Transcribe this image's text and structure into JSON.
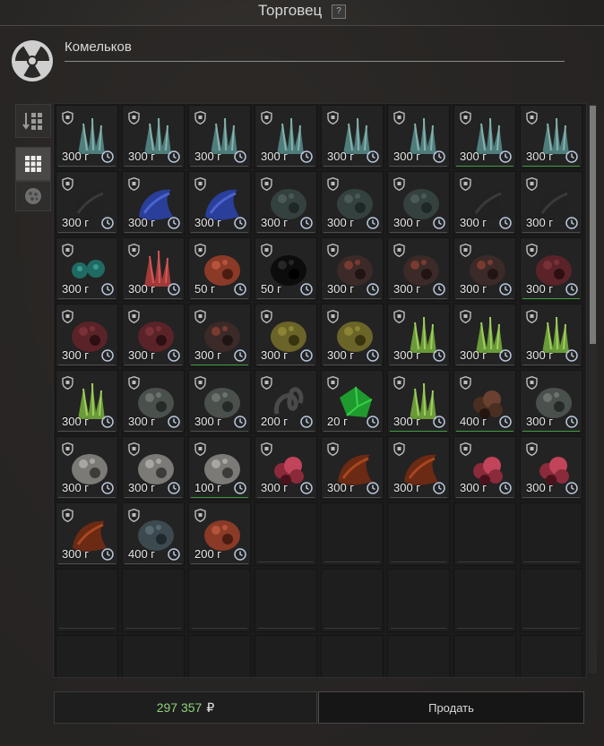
{
  "window": {
    "title": "Торговец",
    "help_label": "?"
  },
  "trader": {
    "name": "Комельков",
    "logo_icon": "radiation-icon"
  },
  "side_tools": [
    {
      "icon": "sort-icon",
      "active": false
    },
    {
      "icon": "grid-view-icon",
      "active": true
    },
    {
      "icon": "artifact-filter-icon",
      "active": false
    }
  ],
  "currency_suffix": "г",
  "colors": {
    "accent_green": "#3f9a3f",
    "total_green": "#8fd17a"
  },
  "grid": {
    "columns": 8,
    "rows": 9,
    "items": [
      {
        "price": "300 г",
        "art": "crystal-teal",
        "green": false
      },
      {
        "price": "300 г",
        "art": "crystal-teal",
        "green": false
      },
      {
        "price": "300 г",
        "art": "crystal-teal",
        "green": false
      },
      {
        "price": "300 г",
        "art": "crystal-teal",
        "green": false
      },
      {
        "price": "300 г",
        "art": "crystal-teal",
        "green": false
      },
      {
        "price": "300 г",
        "art": "crystal-teal",
        "green": false
      },
      {
        "price": "300 г",
        "art": "crystal-teal",
        "green": true
      },
      {
        "price": "300 г",
        "art": "crystal-teal",
        "green": true
      },
      {
        "price": "300 г",
        "art": "dark-claw",
        "green": false
      },
      {
        "price": "300 г",
        "art": "blue-shell",
        "green": false
      },
      {
        "price": "300 г",
        "art": "blue-shell",
        "green": false
      },
      {
        "price": "300 г",
        "art": "dark-cluster",
        "green": false
      },
      {
        "price": "300 г",
        "art": "dark-cluster",
        "green": false
      },
      {
        "price": "300 г",
        "art": "dark-cluster",
        "green": false
      },
      {
        "price": "300 г",
        "art": "dark-claw",
        "green": false
      },
      {
        "price": "300 г",
        "art": "dark-claw",
        "green": false
      },
      {
        "price": "300 г",
        "art": "teal-balls",
        "green": false
      },
      {
        "price": "300 г",
        "art": "red-crystal",
        "green": false
      },
      {
        "price": "50 г",
        "art": "red-rock",
        "green": false
      },
      {
        "price": "50 г",
        "art": "black-blob",
        "green": false
      },
      {
        "price": "300 г",
        "art": "lava-rock",
        "green": false
      },
      {
        "price": "300 г",
        "art": "lava-rock",
        "green": false
      },
      {
        "price": "300 г",
        "art": "lava-rock",
        "green": false
      },
      {
        "price": "300 г",
        "art": "red-sphere",
        "green": true
      },
      {
        "price": "300 г",
        "art": "red-sphere",
        "green": false
      },
      {
        "price": "300 г",
        "art": "red-sphere",
        "green": false
      },
      {
        "price": "300 г",
        "art": "lava-rock",
        "green": true
      },
      {
        "price": "300 г",
        "art": "olive-ball",
        "green": false
      },
      {
        "price": "300 г",
        "art": "olive-ball",
        "green": false
      },
      {
        "price": "300 г",
        "art": "green-crystal",
        "green": false
      },
      {
        "price": "300 г",
        "art": "green-crystal",
        "green": false
      },
      {
        "price": "300 г",
        "art": "green-crystal",
        "green": false
      },
      {
        "price": "300 г",
        "art": "green-crystal",
        "green": false
      },
      {
        "price": "300 г",
        "art": "grey-shell",
        "green": false
      },
      {
        "price": "300 г",
        "art": "grey-shell",
        "green": false
      },
      {
        "price": "200 г",
        "art": "black-knot",
        "green": false
      },
      {
        "price": "20 г",
        "art": "emerald",
        "green": false
      },
      {
        "price": "300 г",
        "art": "green-crystal",
        "green": true
      },
      {
        "price": "400 г",
        "art": "brown-bush",
        "green": true
      },
      {
        "price": "300 г",
        "art": "grey-shell",
        "green": true
      },
      {
        "price": "300 г",
        "art": "grey-rose",
        "green": false
      },
      {
        "price": "300 г",
        "art": "grey-rose",
        "green": false
      },
      {
        "price": "100 г",
        "art": "grey-rose",
        "green": true
      },
      {
        "price": "300 г",
        "art": "red-coral",
        "green": false
      },
      {
        "price": "300 г",
        "art": "flame-shell",
        "green": false
      },
      {
        "price": "300 г",
        "art": "flame-shell",
        "green": false
      },
      {
        "price": "300 г",
        "art": "red-coral",
        "green": false
      },
      {
        "price": "300 г",
        "art": "red-coral",
        "green": false
      },
      {
        "price": "300 г",
        "art": "flame-shell",
        "green": false
      },
      {
        "price": "400 г",
        "art": "ghost-dust",
        "green": false
      },
      {
        "price": "200 г",
        "art": "red-rock",
        "green": false
      }
    ]
  },
  "footer": {
    "total_amount": "297 357",
    "total_currency": "₽",
    "sell_label": "Продать"
  }
}
